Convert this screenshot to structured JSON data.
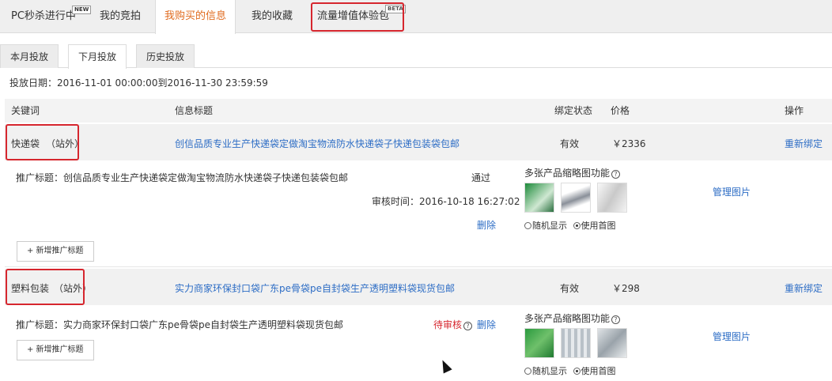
{
  "top_nav": {
    "tabs": [
      {
        "label": "PC秒杀进行中",
        "badge": "NEW"
      },
      {
        "label": "我的竞拍"
      },
      {
        "label": "我购买的信息"
      },
      {
        "label": "我的收藏"
      },
      {
        "label": "流量增值体验包",
        "badge": "BETA"
      }
    ]
  },
  "sub_tabs": [
    "本月投放",
    "下月投放",
    "历史投放"
  ],
  "date_range": "投放日期：2016-11-01 00:00:00到2016-11-30 23:59:59",
  "table": {
    "headers": {
      "keyword": "关键词",
      "title": "信息标题",
      "status": "绑定状态",
      "price": "价格",
      "action": "操作"
    },
    "rows": [
      {
        "keyword": "快递袋",
        "scope": "（站外）",
        "title": "创信品质专业生产快递袋定做淘宝物流防水快递袋子快递包装袋包邮",
        "status": "有效",
        "price": "￥2336",
        "action": "重新绑定",
        "promo_title": "推广标题：创信品质专业生产快递袋定做淘宝物流防水快递袋子快递包装袋包邮",
        "review_status": "通过",
        "review_time": "审核时间：2016-10-18 16:27:02",
        "delete": "删除",
        "multi_img_label": "多张产品缩略图功能",
        "radio_random": "随机显示",
        "radio_first": "使用首图",
        "manage": "管理图片",
        "add_btn": "+ 新增推广标题"
      },
      {
        "keyword": "塑料包装",
        "scope": "（站外）",
        "title": "实力商家环保封口袋广东pe骨袋pe自封袋生产透明塑料袋现货包邮",
        "status": "有效",
        "price": "￥298",
        "action": "重新绑定",
        "promo_title": "推广标题：实力商家环保封口袋广东pe骨袋pe自封袋生产透明塑料袋现货包邮",
        "review_status": "待审核",
        "delete": "删除",
        "multi_img_label": "多张产品缩略图功能",
        "radio_random": "随机显示",
        "radio_first": "使用首图",
        "manage": "管理图片",
        "add_btn": "+ 新增推广标题"
      }
    ]
  },
  "colors": {
    "accent": "#e06b1f",
    "link": "#2d6dc5",
    "highlight_box": "#d6262e"
  }
}
